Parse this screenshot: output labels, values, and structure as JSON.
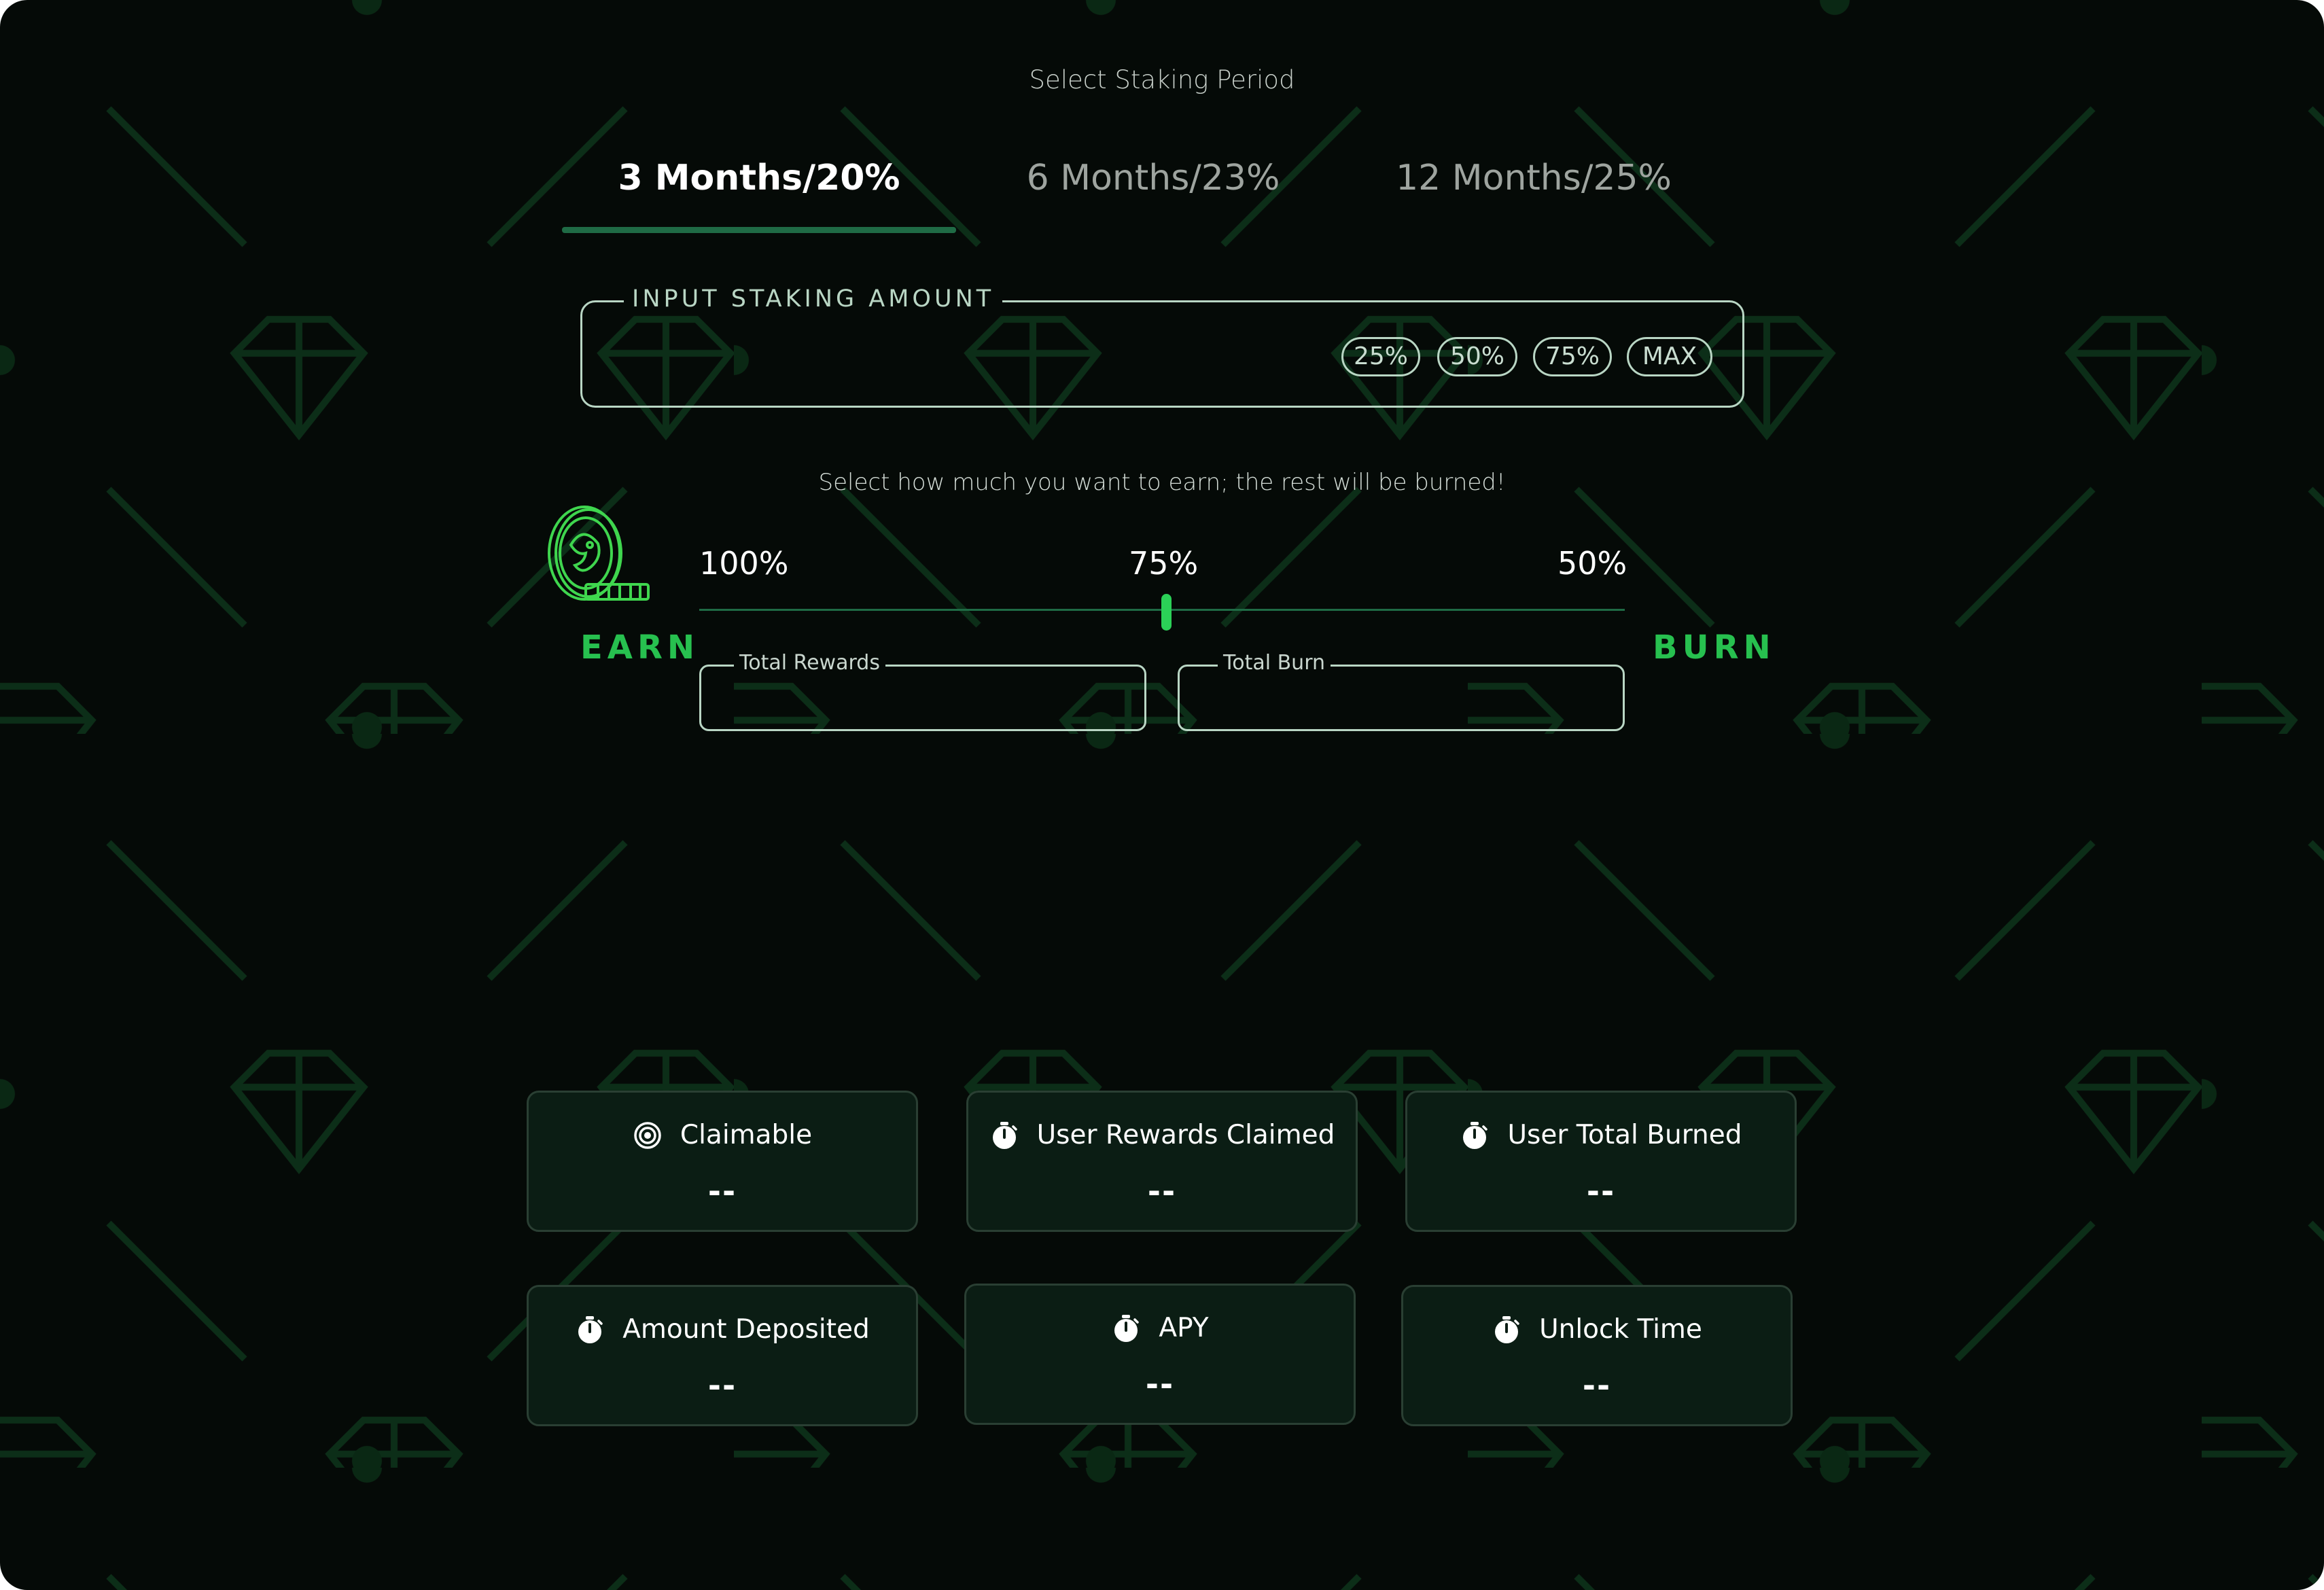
{
  "staking_period": {
    "heading": "Select Staking Period",
    "tabs": [
      {
        "label": "3 Months/20%",
        "active": true
      },
      {
        "label": "6 Months/23%",
        "active": false
      },
      {
        "label": "12 Months/25%",
        "active": false
      }
    ]
  },
  "amount": {
    "legend": "INPUT STAKING AMOUNT",
    "value": "",
    "quick_buttons": [
      "25%",
      "50%",
      "75%",
      "MAX"
    ]
  },
  "earn_burn": {
    "hint": "Select how much you want to earn; the rest will be burned!",
    "earn_label": "EARN",
    "burn_label": "BURN",
    "ticks": [
      "100%",
      "75%",
      "50%"
    ],
    "slider_value_percent": 75,
    "total_rewards_label": "Total Rewards",
    "total_burn_label": "Total Burn",
    "total_rewards_value": "",
    "total_burn_value": ""
  },
  "stats": [
    {
      "label": "Claimable",
      "value": "--",
      "icon": "target-icon"
    },
    {
      "label": "User  Rewards Claimed",
      "value": "--",
      "icon": "stopwatch-icon"
    },
    {
      "label": "User Total Burned",
      "value": "--",
      "icon": "stopwatch-icon"
    },
    {
      "label": "Amount Deposited",
      "value": "--",
      "icon": "stopwatch-icon"
    },
    {
      "label": "APY",
      "value": "--",
      "icon": "stopwatch-icon"
    },
    {
      "label": "Unlock Time",
      "value": "--",
      "icon": "stopwatch-icon"
    }
  ],
  "colors": {
    "background": "#050a07",
    "accent_green": "#27c04f",
    "tab_underline": "#1f6b45",
    "card_background": "#0b1d14",
    "outline": "#b9d6c4"
  }
}
